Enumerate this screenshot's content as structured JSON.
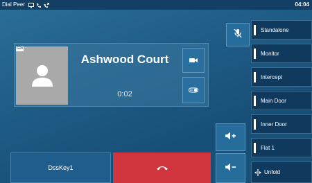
{
  "status_bar": {
    "title": "Dial Peer",
    "time": "04:04",
    "icons": [
      "dnd-screen-icon",
      "phone-icon",
      "call-forward-icon"
    ]
  },
  "call": {
    "avatar_tag": "G2s",
    "callee_name": "Ashwood Court",
    "timer": "0:02",
    "avatar_icon": "person-icon"
  },
  "controls": {
    "mute_icon": "mic-mute-icon",
    "video_icon": "video-camera-icon",
    "door_icon": "door-open-icon",
    "volume_up_icon": "volume-up-icon",
    "volume_down_icon": "volume-down-icon",
    "end_call_icon": "hang-up-icon"
  },
  "bottom": {
    "dsskey1_label": "DssKey1"
  },
  "dss_keys": [
    {
      "label": "Standalone"
    },
    {
      "label": "Monitor"
    },
    {
      "label": "Intercept"
    },
    {
      "label": "Main Door"
    },
    {
      "label": "Inner Door"
    },
    {
      "label": "Flat 1"
    },
    {
      "label": "Unfold",
      "icon": "unfold-icon"
    }
  ],
  "colors": {
    "end_call": "#d0343c",
    "background": "#1f5d86",
    "status_bar": "#123f63"
  }
}
